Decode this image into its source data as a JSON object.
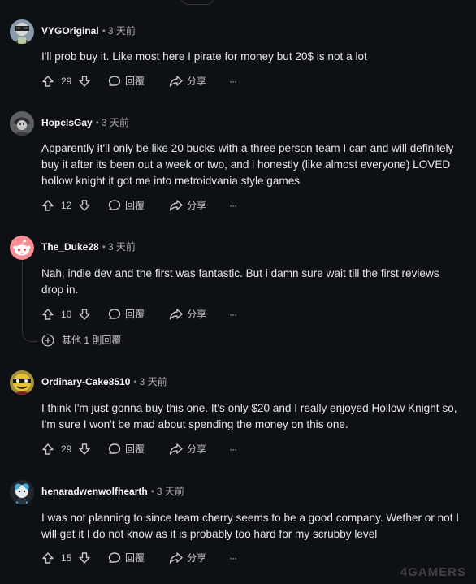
{
  "meta": {
    "separator": "•",
    "actions": {
      "reply": "回覆",
      "share": "分享",
      "more": "···"
    }
  },
  "comments": [
    {
      "author": "VYGOriginal",
      "time": "3 天前",
      "body": [
        "I'll prob buy it. Like most here I pirate for money but 20$ is not a lot"
      ],
      "votes": "29",
      "avatar": "reddit-avatar-icon"
    },
    {
      "author": "HopelsGay",
      "time": "3 天前",
      "body": [
        "Apparently it'll only be like 20 bucks with a three person team I can and will definitely buy it after its been out a week or two, and i honestly (like almost everyone) LOVED hollow knight it got me into metroidvania style games"
      ],
      "votes": "12",
      "avatar": "reddit-avatar-icon"
    },
    {
      "author": "The_Duke28",
      "time": "3 天前",
      "body": [
        "Nah, indie dev and the first was fantastic. But i damn sure wait till the first reviews drop in."
      ],
      "votes": "10",
      "avatar": "snoo-default-avatar-icon",
      "more_replies": "其他 1 則回覆"
    },
    {
      "author": "Ordinary-Cake8510",
      "time": "3 天前",
      "body": [
        "I think I'm just gonna buy this one. It's only $20 and I really enjoyed Hollow Knight so, I'm sure I won't be mad about spending the money on this one."
      ],
      "votes": "29",
      "avatar": "reddit-avatar-icon"
    },
    {
      "author": "henaradwenwolfhearth",
      "time": "3 天前",
      "body": [
        "I was not planning to since team cherry seems to be a good company. Wether or not I will get it I do not know as it is probably too hard for my scrubby level"
      ],
      "votes": "15",
      "avatar": "reddit-avatar-icon"
    }
  ],
  "watermark": "4GAMERS",
  "colors": {
    "background": "#0e1113",
    "text": "#d7dadc",
    "muted": "#a8aaab",
    "thread_line": "#343536"
  }
}
